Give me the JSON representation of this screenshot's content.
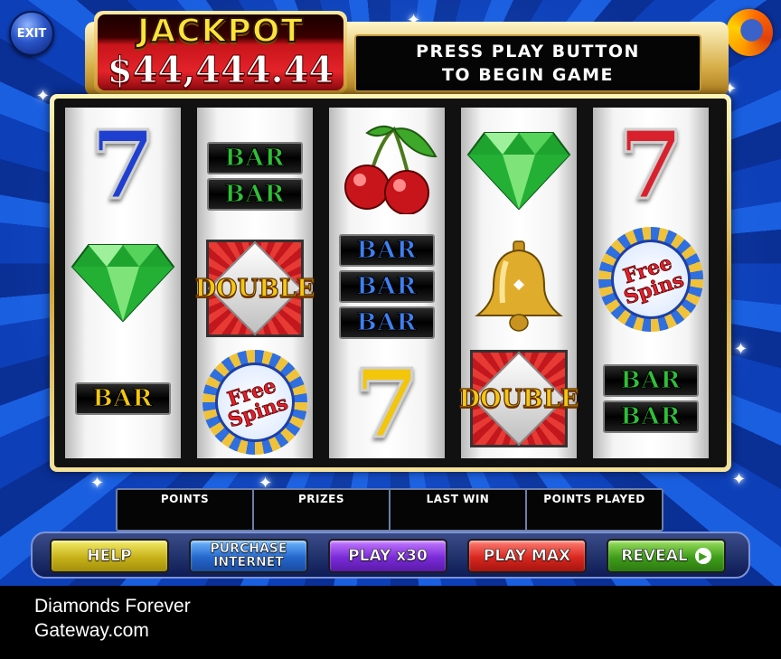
{
  "game": {
    "exit_label": "EXIT",
    "browser_icon": "firefox-icon",
    "jackpot": {
      "label": "JACKPOT",
      "value": "$44,444.44"
    },
    "message": {
      "line1": "PRESS PLAY BUTTON",
      "line2": "TO BEGIN GAME"
    },
    "reels": [
      [
        "seven-blue",
        "diamond-green",
        "bar-yellow"
      ],
      [
        "double-bar-green",
        "double",
        "free-spins"
      ],
      [
        "cherries",
        "triple-bar-blue",
        "seven-yellow"
      ],
      [
        "diamond-green",
        "bell-gold",
        "double"
      ],
      [
        "seven-red",
        "free-spins",
        "double-bar-green"
      ]
    ],
    "symbol_text": {
      "bar": "BAR",
      "double": "DOUBLE",
      "free": "Free",
      "spins": "Spins",
      "seven": "7"
    },
    "counters": {
      "points": "POINTS",
      "prizes": "PRIZES",
      "last_win": "LAST WIN",
      "points_played": "POINTS PLAYED"
    },
    "buttons": {
      "help": "HELP",
      "purchase_line1": "PURCHASE",
      "purchase_line2": "INTERNET",
      "play30": "PLAY x30",
      "play_max": "PLAY MAX",
      "reveal": "REVEAL",
      "reveal_icon": "arrow-right-icon"
    },
    "colors": {
      "jackpot_red": "#e4232a",
      "jackpot_gold": "#ffe23a",
      "help": "#c7b21a",
      "purchase": "#2467cc",
      "play30": "#7a2bd8",
      "play_max": "#d9271f",
      "reveal": "#3f9d1a"
    }
  },
  "caption": {
    "line1": "Diamonds Forever",
    "line2": "Gateway.com"
  }
}
